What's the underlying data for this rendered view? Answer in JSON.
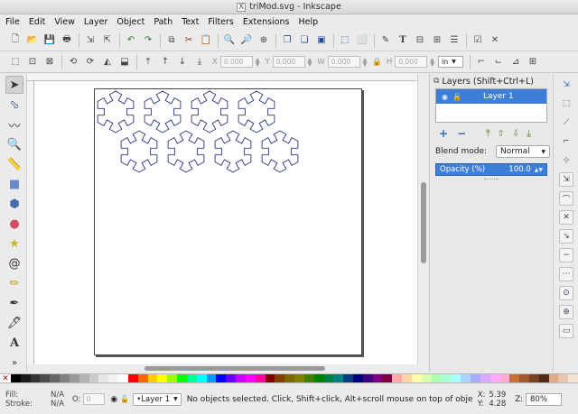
{
  "window": {
    "title": "triMod.svg - Inkscape",
    "title_icon": "X"
  },
  "menu": [
    "File",
    "Edit",
    "View",
    "Layer",
    "Object",
    "Path",
    "Text",
    "Filters",
    "Extensions",
    "Help"
  ],
  "toolbar": {
    "x_label": "X",
    "x_value": "0.000",
    "y_label": "Y",
    "y_value": "0.000",
    "w_label": "W",
    "w_value": "0.000",
    "h_label": "H",
    "h_value": "0.000",
    "units": "in"
  },
  "layers_panel": {
    "title": "Layers (Shift+Ctrl+L)",
    "layer_name": "Layer 1",
    "blend_label": "Blend mode:",
    "blend_value": "Normal",
    "opacity_label": "Opacity (%)",
    "opacity_value": "100.0"
  },
  "canvas": {
    "stroke_color": "#2c3580"
  },
  "status": {
    "fill_label": "Fill:",
    "fill_value": "N/A",
    "stroke_label": "Stroke:",
    "stroke_value": "N/A",
    "opacity_label": "O:",
    "opacity_value": "0",
    "layer_select": "•Layer 1",
    "message": "No objects selected. Click, Shift+click, Alt+scroll mouse on top of objects, or",
    "x_label": "X:",
    "x_value": "5.39",
    "y_label": "Y:",
    "y_value": "4.28",
    "zoom_label": "Z:",
    "zoom_value": "80%"
  },
  "palette": [
    "#000000",
    "#1a1a1a",
    "#333333",
    "#4d4d4d",
    "#666666",
    "#808080",
    "#999999",
    "#b3b3b3",
    "#cccccc",
    "#e6e6e6",
    "#f2f2f2",
    "#ffffff",
    "#ff0000",
    "#ff6600",
    "#ffcc00",
    "#ffff00",
    "#99ff00",
    "#00ff00",
    "#00ff99",
    "#00ffff",
    "#0099ff",
    "#0000ff",
    "#6600ff",
    "#cc00ff",
    "#ff00ff",
    "#ff0099",
    "#800000",
    "#804000",
    "#806600",
    "#808000",
    "#408000",
    "#008000",
    "#008040",
    "#008080",
    "#004080",
    "#000080",
    "#400080",
    "#800080",
    "#800040",
    "#ffaaaa",
    "#ffd5aa",
    "#ffffaa",
    "#d5ffaa",
    "#aaffaa",
    "#aaffd5",
    "#aaffff",
    "#aad5ff",
    "#aaaaff",
    "#d5aaff",
    "#ffaaff",
    "#ffaad5",
    "#c87137",
    "#a05a2c",
    "#784421",
    "#502d16",
    "#deaa87",
    "#e9c6af",
    "#f4e3d7"
  ]
}
